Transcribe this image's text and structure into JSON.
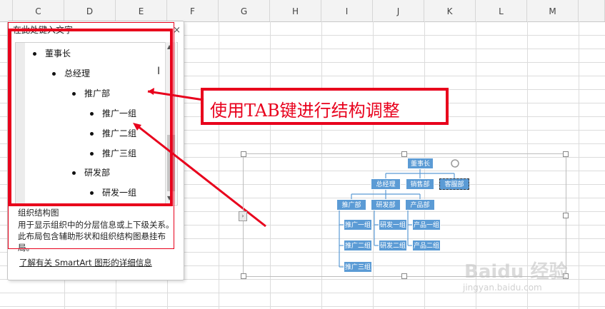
{
  "columns": [
    "C",
    "D",
    "E",
    "F",
    "G",
    "H",
    "I",
    "J",
    "K",
    "L",
    "M"
  ],
  "pane": {
    "title": "在此处键入文字",
    "close": "×",
    "items": [
      "董事长",
      "总经理",
      "推广部",
      "推广一组",
      "推广二组",
      "推广三组",
      "研发部",
      "研发一组"
    ],
    "desc_title": "组织结构图",
    "desc_text": "用于显示组织中的分层信息或上下级关系。此布局包含辅助形状和组织结构图悬挂布局。",
    "link": "了解有关 SmartArt 图形的详细信息",
    "scroll_up": "▲",
    "scroll_down": "▼"
  },
  "callout": "使用TAB键进行结构调整",
  "smartart": {
    "root": "董事长",
    "level2": [
      "总经理",
      "销售部",
      "客服部"
    ],
    "level3": [
      "推广部",
      "研发部",
      "产品部"
    ],
    "col1": [
      "推广一组",
      "推广二组",
      "推广三组"
    ],
    "col2": [
      "研发一组",
      "研发二组"
    ],
    "col3": [
      "产品一组",
      "产品二组"
    ]
  },
  "watermark": {
    "brand": "Baidu 经验",
    "url": "jingyan.baidu.com"
  },
  "colors": {
    "accent_red": "#e8001c",
    "node_blue": "#5b9bd5"
  }
}
